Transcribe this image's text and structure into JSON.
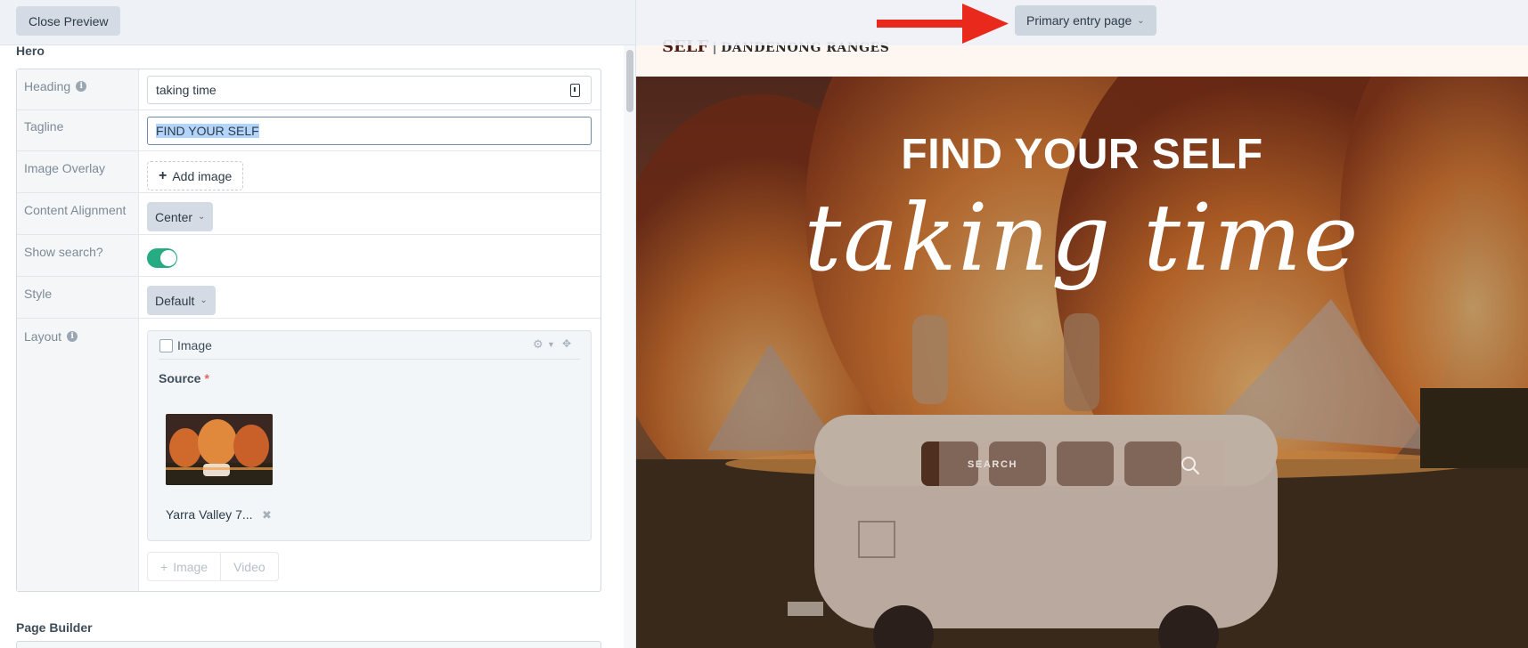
{
  "left": {
    "close_preview": "Close Preview",
    "hero_section": "Hero",
    "page_builder_section": "Page Builder",
    "fields": {
      "heading": {
        "label": "Heading",
        "value": "taking time"
      },
      "tagline": {
        "label": "Tagline",
        "value": "FIND YOUR SELF"
      },
      "image_overlay": {
        "label": "Image Overlay",
        "button": "Add image"
      },
      "content_alignment": {
        "label": "Content Alignment",
        "value": "Center"
      },
      "show_search": {
        "label": "Show search?",
        "on": true
      },
      "style": {
        "label": "Style",
        "value": "Default"
      },
      "layout": {
        "label": "Layout",
        "block_label": "Image",
        "source_label": "Source",
        "required_mark": "*",
        "asset_name": "Yarra Valley 7...",
        "remove_mark": "✖",
        "new_buttons": [
          "Image",
          "Video"
        ]
      }
    }
  },
  "preview": {
    "entry_select": "Primary entry page",
    "brand_self": "SELF",
    "brand_sep": "|",
    "brand_place": "DANDENONG RANGES",
    "hero_tagline": "FIND YOUR SELF",
    "hero_heading": "taking time",
    "search_placeholder": "SEARCH"
  },
  "colors": {
    "toggle_on": "#27ab83",
    "annotation_arrow": "#e8291c",
    "brand": "#4b1a12"
  },
  "icons": [
    "info-icon",
    "field-settings-icon",
    "plus-icon",
    "chevron-down-icon",
    "gear-icon",
    "move-icon",
    "remove-icon",
    "search-icon",
    "arrow-annotation"
  ]
}
